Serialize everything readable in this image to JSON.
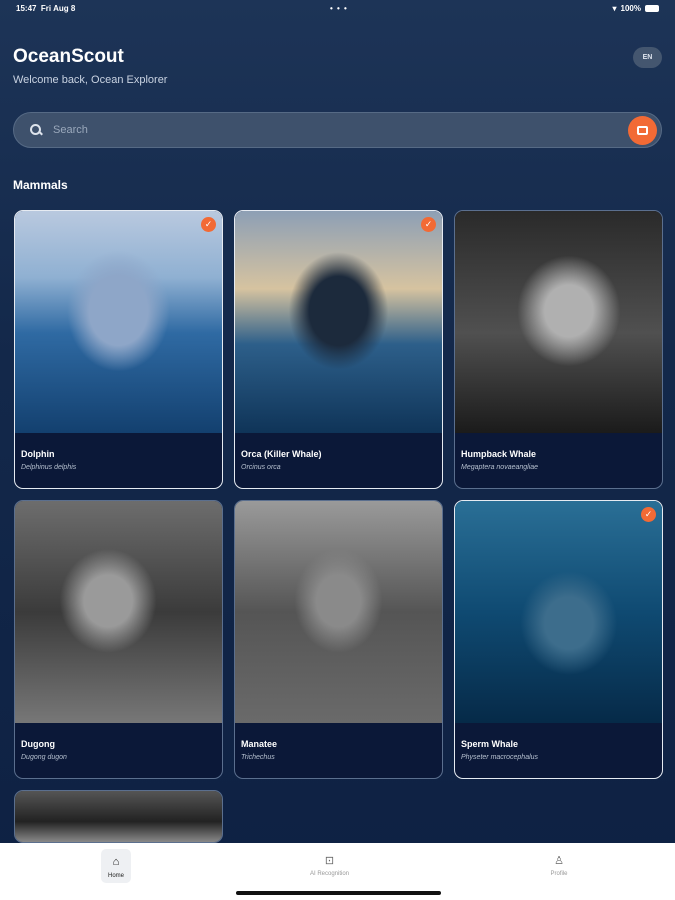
{
  "status": {
    "time": "15:47",
    "date": "Fri Aug 8",
    "battery": "100%"
  },
  "header": {
    "title": "OceanScout",
    "subtitle": "Welcome back, Ocean Explorer",
    "lang": "EN"
  },
  "search": {
    "placeholder": "Search"
  },
  "section": "Mammals",
  "cards": [
    {
      "name": "Dolphin",
      "sci": "Delphinus delphis",
      "selected": true
    },
    {
      "name": "Orca (Killer Whale)",
      "sci": "Orcinus orca",
      "selected": true
    },
    {
      "name": "Humpback Whale",
      "sci": "Megaptera novaeangliae",
      "selected": false
    },
    {
      "name": "Dugong",
      "sci": "Dugong dugon",
      "selected": false
    },
    {
      "name": "Manatee",
      "sci": "Trichechus",
      "selected": false
    },
    {
      "name": "Sperm Whale",
      "sci": "Physeter macrocephalus",
      "selected": true
    }
  ],
  "accent": "#f26a35",
  "nav": [
    {
      "label": "Home"
    },
    {
      "label": "AI Recognition"
    },
    {
      "label": "Profile"
    }
  ]
}
